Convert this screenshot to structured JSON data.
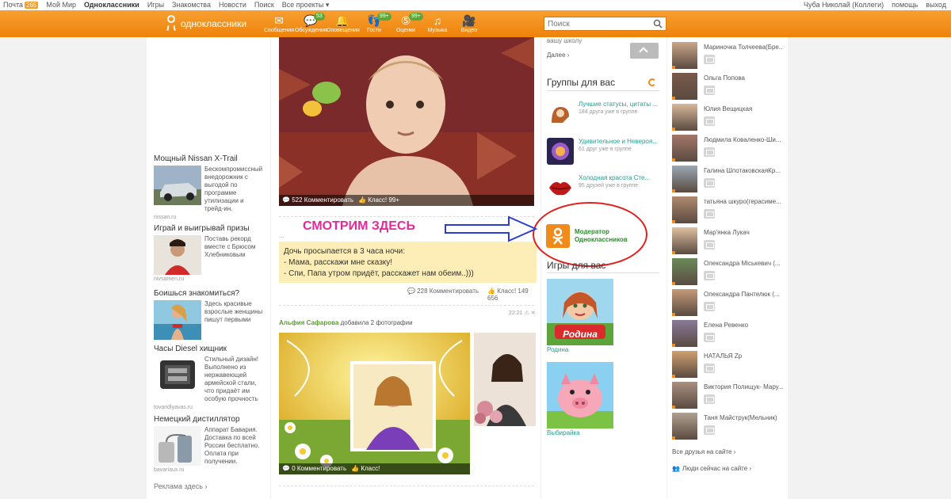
{
  "topbar": {
    "links": [
      {
        "label": "Почта",
        "badge": "265"
      },
      {
        "label": "Мой Мир"
      },
      {
        "label": "Одноклассники",
        "bold": true
      },
      {
        "label": "Игры"
      },
      {
        "label": "Знакомства"
      },
      {
        "label": "Новости"
      },
      {
        "label": "Поиск"
      },
      {
        "label": "Все проекты ▾"
      }
    ],
    "user": "Чуба Николай (Коллеги)",
    "help": "помощь",
    "logout": "выход"
  },
  "header": {
    "logo_text": "одноклассники",
    "nav": [
      {
        "label": "Сообщения",
        "icon": "envelope-icon",
        "glyph": "✉"
      },
      {
        "label": "Обсуждения",
        "icon": "chat-icon",
        "glyph": "💬",
        "count": "53"
      },
      {
        "label": "Оповещения",
        "icon": "bell-icon",
        "glyph": "🔔"
      },
      {
        "label": "Гости",
        "icon": "footprints-icon",
        "glyph": "👣",
        "count": "99+"
      },
      {
        "label": "Оценки",
        "icon": "rating-icon",
        "glyph": "⑤",
        "count": "99+"
      },
      {
        "label": "Музыка",
        "icon": "music-icon",
        "glyph": "♫"
      },
      {
        "label": "Видео",
        "icon": "video-icon",
        "glyph": "🎥"
      }
    ],
    "search_placeholder": "Поиск"
  },
  "left_ads": [
    {
      "title": "Мощный Nissan X-Trail",
      "text": "Бескомпромиссный внедорожник с выгодой по программе утилизации и трейд-ин.",
      "source": "nissan.ru"
    },
    {
      "title": "Играй и выигрывай призы",
      "text": "Поставь рекорд вместе с Брюсом Хлебниковым",
      "source": "nivsamen.ru"
    },
    {
      "title": "Боишься знакомиться?",
      "text": "Здесь красивые взрослые женщины пишут первыми",
      "source": ""
    },
    {
      "title": "Часы Diesel хищник",
      "text": "Стильный дизайн! Выполнено из нержавеющей армейской стали, что придаёт им особую прочность",
      "source": "tovaridlyavas.ru"
    },
    {
      "title": "Немецкий дистиллятор",
      "text": "Аппарат Бавария. Доставка по всей России бесплатно. Оплата при получении.",
      "source": "bavariaux.ru"
    }
  ],
  "ads_link": "Реклама здесь ›",
  "feed": {
    "post1": {
      "comments": "522 Комментировать",
      "likes": "Класс! 99+"
    },
    "watch_here": "СМОТРИМ ЗДЕСЬ",
    "joke_lines": [
      "Дочь просыпается в 3 часа ночи:",
      "- Мама, расскажи мне сказку!",
      "- Спи, Папа утром придёт, расскажет нам обеим..)))"
    ],
    "joke_comments": "228 Комментировать",
    "joke_likes": "Класс! 149 656",
    "post2": {
      "time": "22:21",
      "author": "Альфия Сафарова",
      "action": "добавила 2 фотографии",
      "comments": "0 Комментировать",
      "likes": "Класс!"
    }
  },
  "right": {
    "school": "вашу школу",
    "more": "Далее ›",
    "groups_title": "Группы для вас",
    "groups": [
      {
        "name": "Лучшие статусы, цитаты ...",
        "sub": "184 друга уже в группе"
      },
      {
        "name": "Удивительное и Невероя...",
        "sub": "61 друг уже в группе"
      },
      {
        "name": "Холодная красота Сте...",
        "sub": "95 друзей уже в группе"
      }
    ],
    "moderator": "Модератор Одноклассников",
    "games_title": "Игры для вас",
    "games": [
      {
        "name": "Родина",
        "logo": "Родина"
      },
      {
        "name": "Выбирайка"
      }
    ]
  },
  "friends": [
    "Мариночка Толчеева(Бре...",
    "Ольга Попова",
    "Юлия Вещицкая",
    "Людмила Коваленко-Ши...",
    "Галина ШпотаковскаяКр...",
    "татьяна шкуро(герасиме...",
    "Мар'янка Лукач",
    "Олександра Міськевич (...",
    "Олександра Пантелюк (...",
    "Елена Ревенко",
    "НАТАЛЬЯ Zp",
    "Виктория Полищук- Мару...",
    "Таня Майструк(Мельник)"
  ],
  "friends_all": "Все друзья на сайте ›",
  "friends_online": "Люди сейчас на сайте ›",
  "colors": {
    "accent": "#f08a1a",
    "magenta": "#e5289c",
    "annotation_red": "#e31e1e",
    "annotation_blue": "#2a3fcf"
  }
}
